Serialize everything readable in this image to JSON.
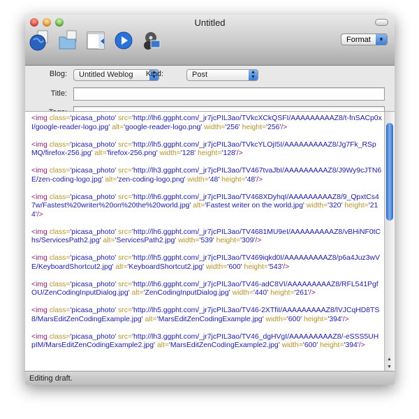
{
  "window": {
    "title": "Untitled",
    "colors": {
      "close": "#e0443e",
      "minimize": "#f0a030",
      "zoom": "#5fc040"
    }
  },
  "toolbar": {
    "icons": [
      "send-to-blog-icon",
      "media-folder-icon",
      "preview-pane-icon",
      "play-icon",
      "media-browser-icon"
    ],
    "format_label": "Format"
  },
  "form": {
    "blog_label": "Blog:",
    "blog_value": "Untitled Weblog",
    "kind_label": "Kind:",
    "kind_value": "Post",
    "title_label": "Title:",
    "title_value": "",
    "tags_label": "Tags:",
    "tags_value": ""
  },
  "editor": {
    "entries": [
      [
        [
          "<img ",
          "tag"
        ],
        [
          "class=",
          "attr"
        ],
        [
          "'picasa_photo' ",
          "val"
        ],
        [
          "src=",
          "attr"
        ],
        [
          "'http://lh6.ggpht.com/_jr7jcPIL3ao/TVkcXCkQSFI/AAAAAAAAAZ8/t-fnSACp0xI/google-reader-logo.jpg' ",
          "val"
        ],
        [
          "alt=",
          "attr"
        ],
        [
          "'google-reader-logo.png' ",
          "val"
        ],
        [
          "width=",
          "attr"
        ],
        [
          "'256' ",
          "val"
        ],
        [
          "height=",
          "attr"
        ],
        [
          "'256'",
          "val"
        ],
        [
          "/>",
          "tag"
        ]
      ],
      [
        [
          "<img ",
          "tag"
        ],
        [
          "class=",
          "attr"
        ],
        [
          "'picasa_photo' ",
          "val"
        ],
        [
          "src=",
          "attr"
        ],
        [
          "'http://lh5.ggpht.com/_jr7jcPIL3ao/TVkcYLOjI5I/AAAAAAAAAZ8/Jg7Fk_RSpMQ/firefox-256.jpg' ",
          "val"
        ],
        [
          "alt=",
          "attr"
        ],
        [
          "'firefox-256.png' ",
          "val"
        ],
        [
          "width=",
          "attr"
        ],
        [
          "'128' ",
          "val"
        ],
        [
          "height=",
          "attr"
        ],
        [
          "'128'",
          "val"
        ],
        [
          "/>",
          "tag"
        ]
      ],
      [
        [
          "<img ",
          "tag"
        ],
        [
          "class=",
          "attr"
        ],
        [
          "'picasa_photo' ",
          "val"
        ],
        [
          "src=",
          "attr"
        ],
        [
          "'http://lh3.ggpht.com/_jr7jcPIL3ao/TV467tvaJbI/AAAAAAAAAZ8/J9Wy9cJTN6E/zen-coding-logo.jpg' ",
          "val"
        ],
        [
          "alt=",
          "attr"
        ],
        [
          "'zen-coding-logo.png' ",
          "val"
        ],
        [
          "width=",
          "attr"
        ],
        [
          "'48' ",
          "val"
        ],
        [
          "height=",
          "attr"
        ],
        [
          "'48'",
          "val"
        ],
        [
          "/>",
          "tag"
        ]
      ],
      [
        [
          "<img ",
          "tag"
        ],
        [
          "class=",
          "attr"
        ],
        [
          "'picasa_photo' ",
          "val"
        ],
        [
          "src=",
          "attr"
        ],
        [
          "'http://lh6.ggpht.com/_jr7jcPIL3ao/TV468XDyhqI/AAAAAAAAAZ8/9_QpxtCs47w/Fastest%20writer%20on%20the%20world.jpg' ",
          "val"
        ],
        [
          "alt=",
          "attr"
        ],
        [
          "'Fastest writer on the world.jpg' ",
          "val"
        ],
        [
          "width=",
          "attr"
        ],
        [
          "'320' ",
          "val"
        ],
        [
          "height=",
          "attr"
        ],
        [
          "'214'",
          "val"
        ],
        [
          "/>",
          "tag"
        ]
      ],
      [
        [
          "<img ",
          "tag"
        ],
        [
          "class=",
          "attr"
        ],
        [
          "'picasa_photo' ",
          "val"
        ],
        [
          "src=",
          "attr"
        ],
        [
          "'http://lh6.ggpht.com/_jr7jcPIL3ao/TV4681MU9eI/AAAAAAAAAZ8/vBHiNF0tChs/ServicesPath2.jpg' ",
          "val"
        ],
        [
          "alt=",
          "attr"
        ],
        [
          "'ServicesPath2.jpg' ",
          "val"
        ],
        [
          "width=",
          "attr"
        ],
        [
          "'539' ",
          "val"
        ],
        [
          "height=",
          "attr"
        ],
        [
          "'309'",
          "val"
        ],
        [
          "/>",
          "tag"
        ]
      ],
      [
        [
          "<img ",
          "tag"
        ],
        [
          "class=",
          "attr"
        ],
        [
          "'picasa_photo' ",
          "val"
        ],
        [
          "src=",
          "attr"
        ],
        [
          "'http://lh5.ggpht.com/_jr7jcPIL3ao/TV469iqkd0I/AAAAAAAAAZ8/p6a4Juz3wVE/KeyboardShortcut2.jpg' ",
          "val"
        ],
        [
          "alt=",
          "attr"
        ],
        [
          "'KeyboardShortcut2.jpg' ",
          "val"
        ],
        [
          "width=",
          "attr"
        ],
        [
          "'600' ",
          "val"
        ],
        [
          "height=",
          "attr"
        ],
        [
          "'543'",
          "val"
        ],
        [
          "/>",
          "tag"
        ]
      ],
      [
        [
          "<img ",
          "tag"
        ],
        [
          "class=",
          "attr"
        ],
        [
          "'picasa_photo' ",
          "val"
        ],
        [
          "src=",
          "attr"
        ],
        [
          "'http://lh6.ggpht.com/_jr7jcPIL3ao/TV46-adC8VI/AAAAAAAAAZ8/RFL541PgfOU/ZenCodingInputDialog.jpg' ",
          "val"
        ],
        [
          "alt=",
          "attr"
        ],
        [
          "'ZenCodingInputDialog.jpg' ",
          "val"
        ],
        [
          "width=",
          "attr"
        ],
        [
          "'440' ",
          "val"
        ],
        [
          "height=",
          "attr"
        ],
        [
          "'261'",
          "val"
        ],
        [
          "/>",
          "tag"
        ]
      ],
      [
        [
          "<img ",
          "tag"
        ],
        [
          "class=",
          "attr"
        ],
        [
          "'picasa_photo' ",
          "val"
        ],
        [
          "src=",
          "attr"
        ],
        [
          "'http://lh5.ggpht.com/_jr7jcPIL3ao/TV46-2XTfiI/AAAAAAAAAZ8/lVJCqHD8TS8/MarsEditZenCodingExample.jpg' ",
          "val"
        ],
        [
          "alt=",
          "attr"
        ],
        [
          "'MarsEditZenCodingExample.jpg' ",
          "val"
        ],
        [
          "width=",
          "attr"
        ],
        [
          "'600' ",
          "val"
        ],
        [
          "height=",
          "attr"
        ],
        [
          "'394'",
          "val"
        ],
        [
          "/>",
          "tag"
        ]
      ],
      [
        [
          "<img ",
          "tag"
        ],
        [
          "class=",
          "attr"
        ],
        [
          "'picasa_photo' ",
          "val"
        ],
        [
          "src=",
          "attr"
        ],
        [
          "'http://lh3.ggpht.com/_jr7jcPIL3ao/TV46_dgHVgI/AAAAAAAAAZ8/-eSSS5UHpIM/MarsEditZenCodingExample2.jpg' ",
          "val"
        ],
        [
          "alt=",
          "attr"
        ],
        [
          "'MarsEditZenCodingExample2.jpg' ",
          "val"
        ],
        [
          "width=",
          "attr"
        ],
        [
          "'600' ",
          "val"
        ],
        [
          "height=",
          "attr"
        ],
        [
          "'394'",
          "val"
        ],
        [
          "/>",
          "tag"
        ]
      ]
    ]
  },
  "status": {
    "text": "Editing draft."
  }
}
